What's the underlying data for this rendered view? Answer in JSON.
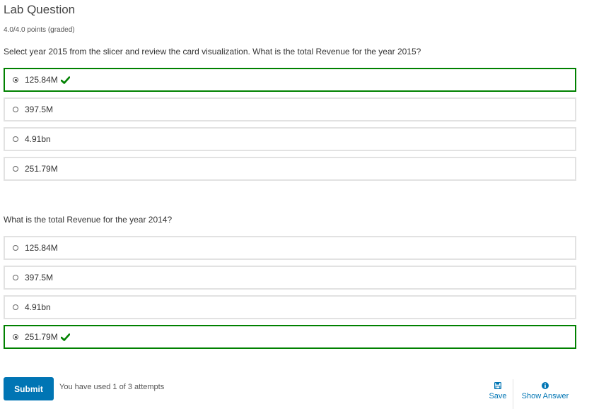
{
  "problem": {
    "title": "Lab Question",
    "points": "4.0/4.0 points (graded)"
  },
  "questions": [
    {
      "prompt": "Select year 2015 from the slicer and review the card visualization. What is the total Revenue for the year 2015?",
      "choices": [
        {
          "label": "125.84M",
          "selected": true,
          "correct": true
        },
        {
          "label": "397.5M",
          "selected": false
        },
        {
          "label": "4.91bn",
          "selected": false
        },
        {
          "label": "251.79M",
          "selected": false
        }
      ]
    },
    {
      "prompt": "What is the total Revenue for the year 2014?",
      "choices": [
        {
          "label": "125.84M",
          "selected": false
        },
        {
          "label": "397.5M",
          "selected": false
        },
        {
          "label": "4.91bn",
          "selected": false
        },
        {
          "label": "251.79M",
          "selected": true,
          "correct": true
        }
      ]
    }
  ],
  "actions": {
    "submit_label": "Submit",
    "attempts_text": "You have used 1 of 3 attempts",
    "save_label": "Save",
    "show_answer_label": "Show Answer"
  },
  "icons": {
    "correct": "check-icon",
    "save": "floppy-disk-icon",
    "show_answer": "info-icon"
  },
  "colors": {
    "correct": "#008100",
    "accent": "#0075b4",
    "border": "#e2e2e2"
  }
}
